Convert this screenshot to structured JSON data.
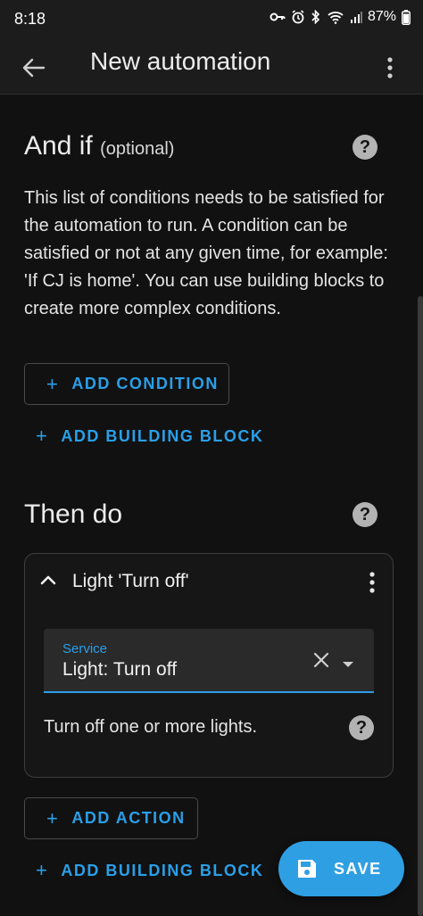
{
  "status_bar": {
    "time": "8:18",
    "battery": "87%"
  },
  "app_bar": {
    "title": "New automation"
  },
  "conditions": {
    "title": "And if",
    "optional": "(optional)",
    "description": "This list of conditions needs to be satisfied for the automation to run. A condition can be satisfied or not at any given time, for example: 'If CJ is home'. You can use building blocks to create more complex conditions.",
    "add_condition": "ADD CONDITION",
    "add_building_block": "ADD BUILDING BLOCK"
  },
  "actions": {
    "title": "Then do",
    "card": {
      "title": "Light 'Turn off'",
      "service_label": "Service",
      "service_value": "Light: Turn off",
      "service_description": "Turn off one or more lights."
    },
    "add_action": "ADD ACTION",
    "add_building_block": "ADD BUILDING BLOCK"
  },
  "save_button": {
    "label": "SAVE"
  },
  "icons": {
    "help": "?",
    "plus": "+"
  },
  "colors": {
    "accent": "#2a9fe8",
    "background": "#111111",
    "app_bar": "#1c1c1c",
    "fab": "#2f9fe3"
  }
}
